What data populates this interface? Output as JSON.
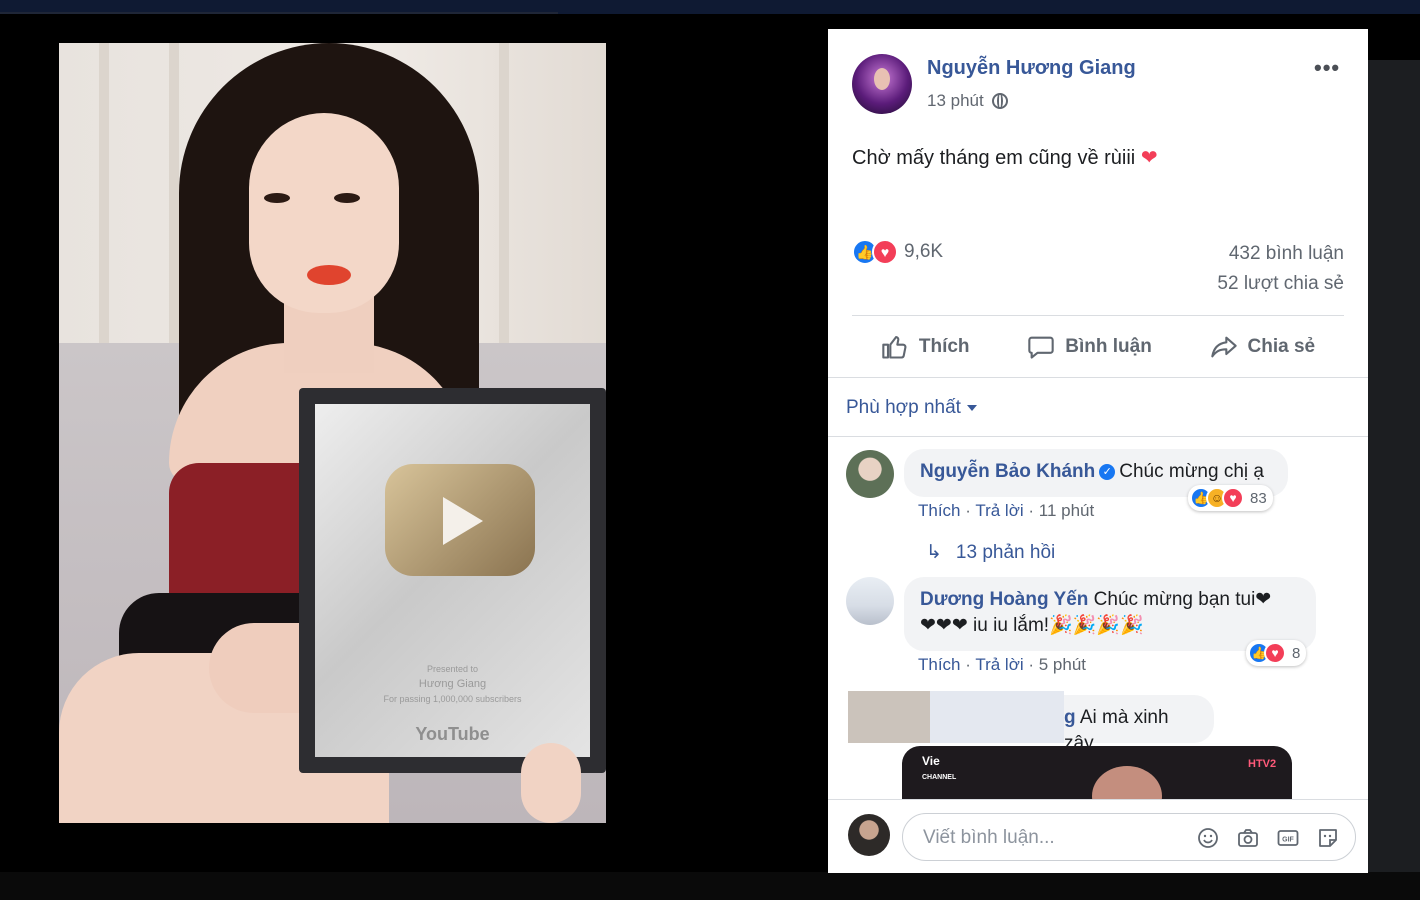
{
  "post": {
    "author": "Nguyễn Hương Giang",
    "time": "13 phút",
    "privacy_icon": "globe-icon",
    "text": "Chờ mấy tháng em cũng về rùiii",
    "text_emoji": "❤",
    "reaction_count": "9,6K",
    "comment_count": "432 bình luận",
    "share_count": "52 lượt chia sẻ",
    "more_label": "•••"
  },
  "actions": {
    "like": "Thích",
    "comment": "Bình luận",
    "share": "Chia sẻ"
  },
  "sort": {
    "label": "Phù hợp nhất"
  },
  "comments": [
    {
      "name": "Nguyễn Bảo Khánh",
      "verified": true,
      "text": "Chúc mừng chị ạ",
      "like": "Thích",
      "reply": "Trả lời",
      "time": "11 phút",
      "reaction_count": "83",
      "replies_label": "13 phản hồi"
    },
    {
      "name": "Dương Hoàng Yến",
      "text_line1": "Chúc mừng bạn tui❤",
      "text_line2": "❤❤❤ iu iu lắm!🎉🎉🎉🎉",
      "like": "Thích",
      "reply": "Trả lời",
      "time": "5 phút",
      "reaction_count": "8"
    },
    {
      "name_tail": "g",
      "text": "Ai mà xinh zậy"
    }
  ],
  "composer": {
    "placeholder": "Viết bình luận...",
    "icons": [
      "emoji-icon",
      "camera-icon",
      "gif-icon",
      "sticker-icon"
    ]
  },
  "photo": {
    "plaque_presented": "Presented to",
    "plaque_name": "Hương Giang",
    "plaque_caption": "For passing 1,000,000 subscribers",
    "plaque_brand": "YouTube"
  },
  "video": {
    "channel_logo": "Vie",
    "channel_sub": "CHANNEL",
    "tv_logo": "HTV2"
  }
}
